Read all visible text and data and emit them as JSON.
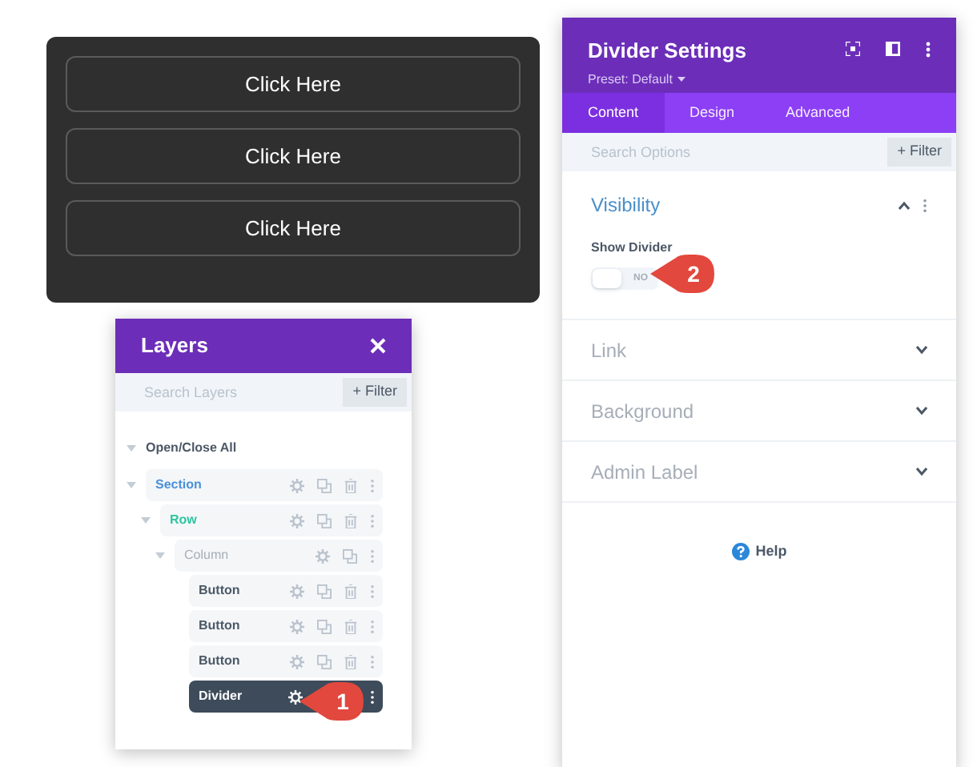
{
  "preview": {
    "buttons": [
      "Click Here",
      "Click Here",
      "Click Here"
    ]
  },
  "layers": {
    "title": "Layers",
    "search": {
      "placeholder": "Search Layers"
    },
    "filter_button": "+ Filter",
    "open_close_all": "Open/Close All",
    "tree": [
      {
        "label": "Section",
        "kind": "section",
        "selected": false,
        "children": [
          {
            "label": "Row",
            "kind": "row",
            "selected": false,
            "children": [
              {
                "label": "Column",
                "kind": "column",
                "selected": false,
                "children": [
                  {
                    "label": "Button",
                    "kind": "module",
                    "selected": false
                  },
                  {
                    "label": "Button",
                    "kind": "module",
                    "selected": false
                  },
                  {
                    "label": "Button",
                    "kind": "module",
                    "selected": false
                  },
                  {
                    "label": "Divider",
                    "kind": "module",
                    "selected": true
                  }
                ]
              }
            ]
          }
        ]
      }
    ]
  },
  "settings": {
    "title": "Divider Settings",
    "preset": "Preset: Default",
    "tabs": [
      {
        "label": "Content",
        "selected": true
      },
      {
        "label": "Design",
        "selected": false
      },
      {
        "label": "Advanced",
        "selected": false
      }
    ],
    "search": {
      "placeholder": "Search Options"
    },
    "filter_button": "+ Filter",
    "groups": [
      {
        "title": "Visibility",
        "expanded": true,
        "field": {
          "label": "Show Divider",
          "toggle": {
            "on": false,
            "text": "NO"
          }
        }
      },
      {
        "title": "Link",
        "expanded": false
      },
      {
        "title": "Background",
        "expanded": false
      },
      {
        "title": "Admin Label",
        "expanded": false
      }
    ],
    "help": "Help"
  },
  "callouts": [
    {
      "number": "1"
    },
    {
      "number": "2"
    }
  ]
}
